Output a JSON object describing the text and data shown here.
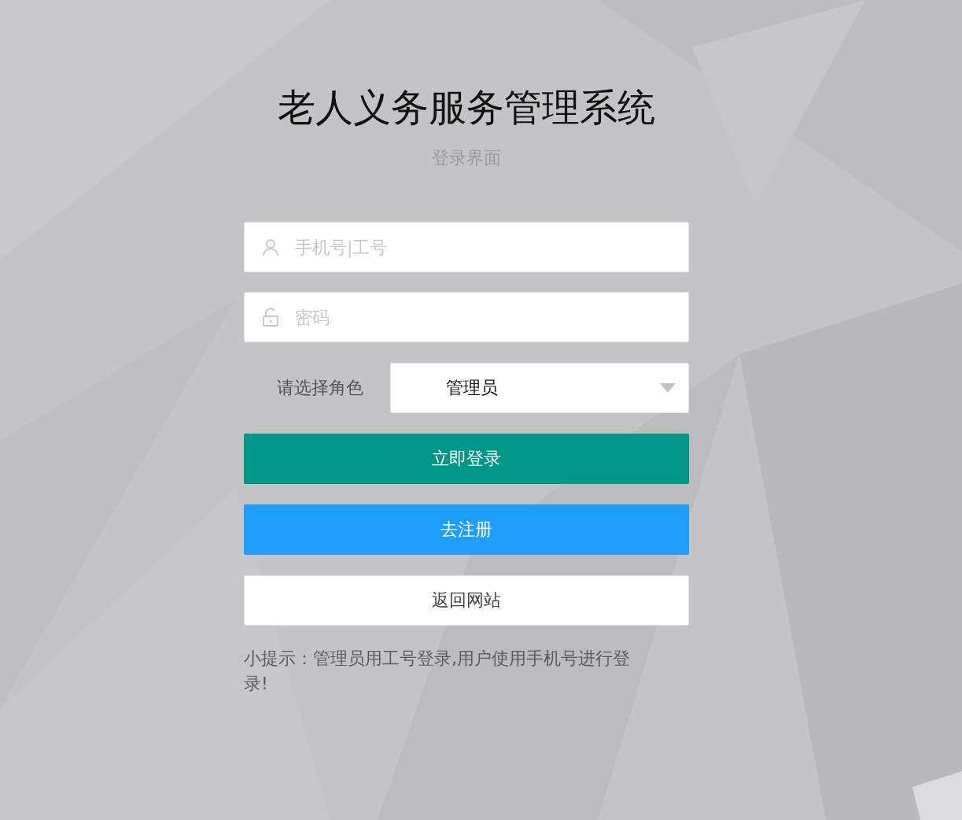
{
  "title": "老人义务服务管理系统",
  "subtitle": "登录界面",
  "fields": [
    {
      "kind": "user",
      "placeholder": "手机号|工号"
    },
    {
      "kind": "password",
      "placeholder": "密码"
    }
  ],
  "role": {
    "label": "请选择角色",
    "value": "管理员"
  },
  "buttons": [
    {
      "kind": "green",
      "label": "立即登录"
    },
    {
      "kind": "blue",
      "label": "去注册"
    },
    {
      "kind": "white",
      "label": "返回网站"
    }
  ],
  "tip": "小提示：管理员用工号登录,用户使用手机号进行登录!"
}
